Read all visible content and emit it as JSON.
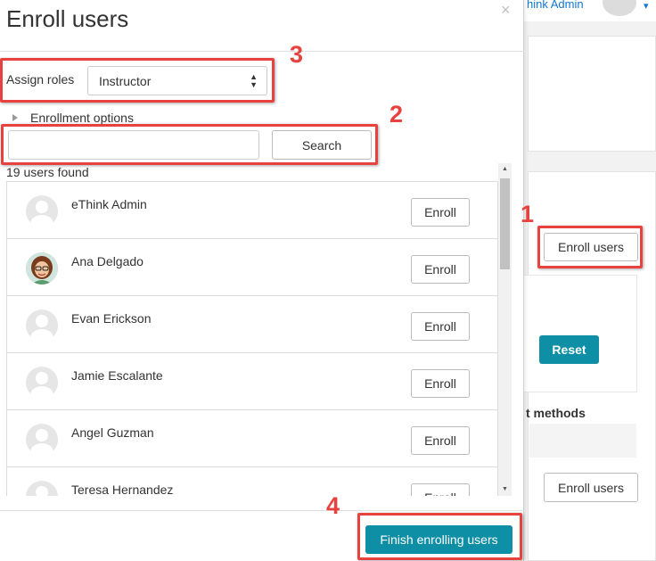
{
  "background": {
    "user_name": "hink Admin",
    "enroll_users_label": "Enroll users",
    "reset_label": "Reset",
    "methods_heading": "t methods",
    "enroll_users_label_2": "Enroll users",
    "colors": {
      "accent": "#0f8fa5",
      "link": "#1177d1"
    }
  },
  "modal": {
    "title": "Enroll users",
    "close_icon": "×",
    "assign_roles_label": "Assign roles",
    "assign_roles_value": "Instructor",
    "enrollment_options_label": "Enrollment options",
    "search": {
      "value": "",
      "placeholder": "",
      "button_label": "Search"
    },
    "users_found": "19 users found",
    "users": [
      {
        "name": "eThink Admin",
        "avatar": "default-avatar-icon",
        "enroll_label": "Enroll"
      },
      {
        "name": "Ana Delgado",
        "avatar": "photo-avatar",
        "enroll_label": "Enroll"
      },
      {
        "name": "Evan Erickson",
        "avatar": "default-avatar-icon",
        "enroll_label": "Enroll"
      },
      {
        "name": "Jamie Escalante",
        "avatar": "default-avatar-icon",
        "enroll_label": "Enroll"
      },
      {
        "name": "Angel Guzman",
        "avatar": "default-avatar-icon",
        "enroll_label": "Enroll"
      },
      {
        "name": "Teresa Hernandez",
        "avatar": "default-avatar-icon",
        "enroll_label": "Enroll"
      }
    ],
    "finish_label": "Finish enrolling users"
  },
  "annotations": {
    "steps": [
      "1",
      "2",
      "3",
      "4"
    ],
    "color": "#e8423f"
  }
}
